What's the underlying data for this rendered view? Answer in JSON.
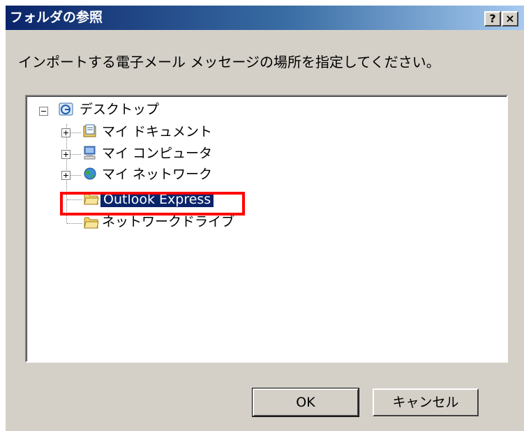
{
  "window": {
    "title": "フォルダの参照",
    "help_label": "?",
    "close_label": "×"
  },
  "instruction": "インポートする電子メール メッセージの場所を指定してください。",
  "tree": {
    "root": {
      "label": "デスクトップ",
      "icon": "desktop-icon",
      "expanded": true
    },
    "children": [
      {
        "label": "マイ ドキュメント",
        "icon": "documents-icon",
        "expandable": true
      },
      {
        "label": "マイ コンピュータ",
        "icon": "computer-icon",
        "expandable": true
      },
      {
        "label": "マイ ネットワーク",
        "icon": "network-icon",
        "expandable": true
      },
      {
        "label": "Outlook Express",
        "icon": "folder-icon",
        "selected": true
      },
      {
        "label": "ネットワークドライブ",
        "icon": "folder-icon"
      }
    ]
  },
  "buttons": {
    "ok": "OK",
    "cancel": "キャンセル"
  },
  "colors": {
    "dialog_bg": "#d4d0c8",
    "title_gradient_start": "#0a246a",
    "selection_bg": "#0a246a",
    "highlight_annotation": "#ff0000"
  }
}
